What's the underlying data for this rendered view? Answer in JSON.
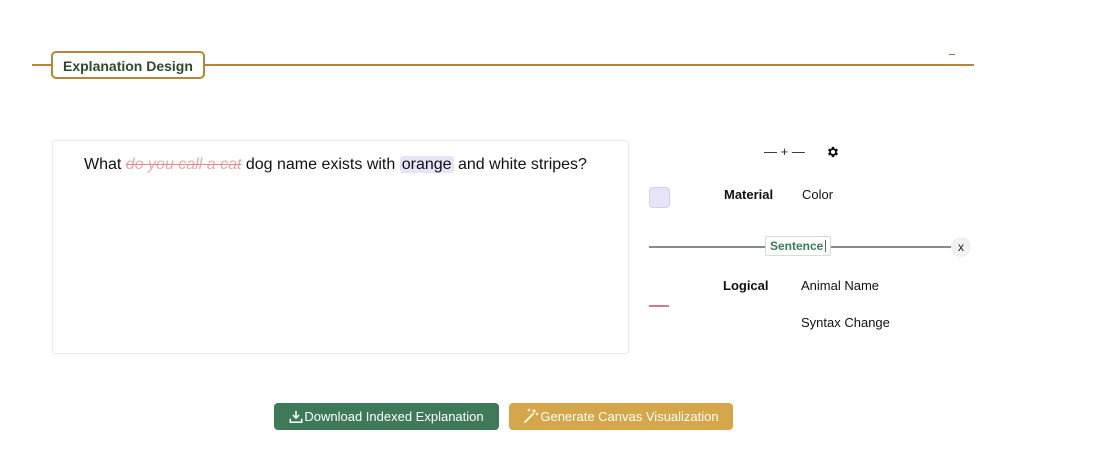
{
  "section": {
    "title": "Explanation Design",
    "collapse_symbol": "−"
  },
  "sentence": {
    "before": "What ",
    "struck": "do you call a cat",
    "middle": " dog name exists with ",
    "highlight": "orange",
    "after": " and white stripes?"
  },
  "toolbar": {
    "zoom_minus": "—",
    "zoom_plus": "+",
    "zoom_minus2": "—",
    "settings_icon": "gear-icon"
  },
  "legend": {
    "material_label": "Material",
    "material_value": "Color",
    "material_color": "#e6e4f6",
    "sentence_label": "Sentence",
    "close_label": "x",
    "logical_label": "Logical",
    "logical_values": [
      "Animal Name",
      "Syntax Change"
    ],
    "logical_color": "#c97e8e"
  },
  "buttons": {
    "download_label": "Download Indexed Explanation",
    "generate_label": "Generate Canvas Visualization"
  },
  "colors": {
    "accent_gold": "#b8853a",
    "green": "#3e7a58",
    "gold_button": "#d6a64a"
  }
}
